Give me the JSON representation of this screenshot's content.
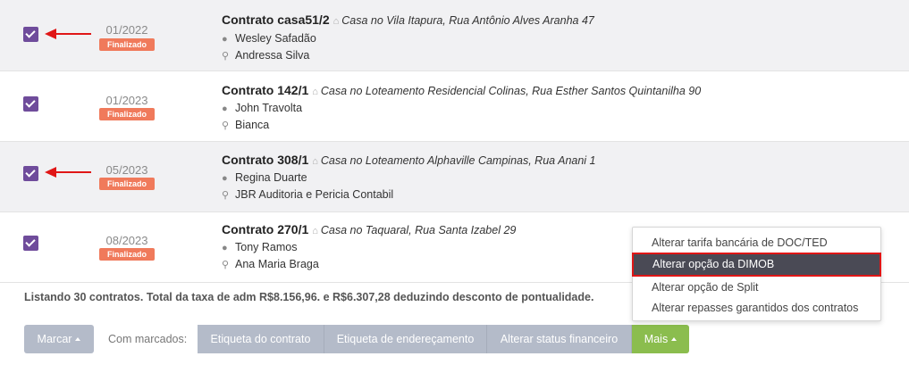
{
  "contracts": [
    {
      "checked": true,
      "date": "01/2022",
      "status": "Finalizado",
      "title": "Contrato casa51/2",
      "address": "Casa no Vila Itapura, Rua Antônio Alves Aranha 47",
      "owner": "Wesley Safadão",
      "tenant": "Andressa Silva",
      "arrow": true
    },
    {
      "checked": true,
      "date": "01/2023",
      "status": "Finalizado",
      "title": "Contrato 142/1",
      "address": "Casa no Loteamento Residencial Colinas, Rua Esther Santos Quintanilha 90",
      "owner": "John Travolta",
      "tenant": "Bianca",
      "arrow": false
    },
    {
      "checked": true,
      "date": "05/2023",
      "status": "Finalizado",
      "title": "Contrato 308/1",
      "address": "Casa no Loteamento Alphaville Campinas, Rua Anani 1",
      "owner": "Regina Duarte",
      "tenant": "JBR Auditoria e Pericia Contabil",
      "arrow": true
    },
    {
      "checked": true,
      "date": "08/2023",
      "status": "Finalizado",
      "title": "Contrato 270/1",
      "address": "Casa no Taquaral, Rua Santa Izabel 29",
      "owner": "Tony Ramos",
      "tenant": "Ana Maria Braga",
      "arrow": false
    }
  ],
  "summary": "Listando 30 contratos. Total da taxa de adm R$8.156,96. e R$6.307,28 deduzindo desconto de pontualidade.",
  "toolbar": {
    "marcar_label": "Marcar",
    "com_marcados_label": "Com marcados:",
    "etiqueta_contrato_label": "Etiqueta do contrato",
    "etiqueta_enderecamento_label": "Etiqueta de endereçamento",
    "alterar_status_label": "Alterar status financeiro",
    "mais_label": "Mais"
  },
  "dropdown": {
    "items": [
      "Alterar tarifa bancária de DOC/TED",
      "Alterar opção da DIMOB",
      "Alterar opção de Split",
      "Alterar repasses garantidos dos contratos"
    ],
    "highlighted_index": 1
  },
  "colors": {
    "checkbox": "#6f4c9b",
    "badge": "#f07a5b",
    "arrow": "#e01616",
    "mais_button": "#8bbd4e",
    "grey_button": "#b4bbc9",
    "highlight_bg": "#4a4a55"
  },
  "icons": {
    "address": "home-icon",
    "owner": "user-icon",
    "tenant": "key-icon",
    "check": "check-icon",
    "caret": "caret-up-icon"
  }
}
